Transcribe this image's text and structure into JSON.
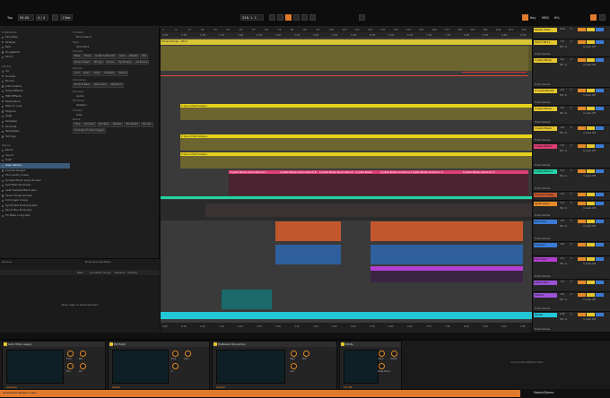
{
  "topbar": {
    "tap": "Tap",
    "tempo": "90.00",
    "signature": "4 / 4",
    "metronome": "1 Bar",
    "position": "226. 1. 1",
    "key": "Key",
    "midi": "MIDI",
    "cpu": "6%"
  },
  "browser": {
    "collections_header": "Collections",
    "collections": [
      "Favorites",
      "Orange",
      "Red",
      "Songstarts",
      "Drum"
    ],
    "library_header": "Library",
    "library": [
      "All",
      "Sounds",
      "Drums",
      "Instruments",
      "Audio Effects",
      "MIDI Effects",
      "Modulators",
      "Max for Live",
      "Plug-Ins",
      "Clips",
      "Samples",
      "Grooves",
      "Templates",
      "Tunings"
    ],
    "places_header": "Places",
    "places": [
      "Packs",
      "Cloud",
      "Push",
      "User Library",
      "Current Project"
    ],
    "user_files": [
      "Flux Audio_2.wav",
      "Sunset Warm Loop 01.wav",
      "Sub Bass Final.wav",
      "Lead Sample Bank.wav",
      "Vocal Chops 04.wav",
      "Kick Layer A.wav",
      "Synth Pad Evolving.wav",
      "Drum Bus Print.wav",
      "FX Riser Long.wav"
    ],
    "filter_col": {
      "content_label": "Content",
      "content_value": "Drum Rack",
      "type_label": "Type",
      "type_value": "One Shot",
      "sound_label": "Sounds",
      "sound_items": [
        "Bass",
        "Brass",
        "Guitar & Plucked",
        "Lead",
        "Mallets",
        "Pad",
        "Piano & Keys",
        "Strings",
        "Voices",
        "Synth Keys",
        "Ambience"
      ],
      "genre_label": "Genres",
      "genre_items": [
        "Acid",
        "Bass",
        "Deep",
        "Dubstep",
        "Techno"
      ],
      "character_label": "Character",
      "character_items": [
        "Drum & Bass",
        "Percussive",
        "Rhythmic"
      ],
      "device_label": "Devices",
      "device_value": "Audio",
      "producer_label": "Producer",
      "producer_value": "Ableton",
      "creator_label": "Creator",
      "creator_value": "User",
      "pack_label": "Packs",
      "file_items": [
        "Clips",
        "Grooves",
        "Samples",
        "Presets",
        "Templates",
        "Tunings",
        "Cmd-Key (Fn Key Trigger)"
      ]
    }
  },
  "groove": {
    "title": "Groove",
    "cols": [
      "Base",
      "Quantize",
      "Timing",
      "Random",
      "Velocity"
    ],
    "empty_hint": "Drop Grooves Here",
    "empty_hint2": "Drop Clips or Grooves Here"
  },
  "arrangement": {
    "ruler_marks": [
      "1",
      "9",
      "17",
      "25",
      "33",
      "41",
      "49",
      "57",
      "65",
      "73",
      "81",
      "89",
      "97",
      "105",
      "113",
      "121",
      "129",
      "137",
      "145",
      "153",
      "161",
      "169",
      "177",
      "185",
      "193",
      "201",
      "209",
      "217",
      "225"
    ],
    "time_marks": [
      "0:00",
      "0:30",
      "1:00",
      "1:30",
      "2:00",
      "2:30",
      "3:00",
      "3:30",
      "4:00",
      "4:30",
      "5:00",
      "5:30",
      "6:00",
      "6:30",
      "7:00",
      "7:30",
      "8:00",
      "8:30",
      "9:00",
      "9:30"
    ],
    "master_clip": "Tempo Tempo - Pitch",
    "yellow_clips": [
      "1 Sound Pad Sample",
      "2 Sound Pad Sample",
      "3 Sound Pad Sample"
    ],
    "pink_clips": [
      "Crystal Bowls Supernatural A",
      "Crystal Bowls Supernatural B",
      "Crystal Bowls Supernatural C",
      "Crystal Bowls",
      "Crystal Bowls Guidance 3",
      "Crystal Bowls Guidance 4",
      "Crystal Bowls Guidance 5"
    ],
    "loop_region": "1/1",
    "end_marker": "1/1"
  },
  "mixer": {
    "tracks": [
      {
        "name": "Master Fader",
        "color": "#e6c62e",
        "vol": "0.00",
        "pan": "C"
      },
      {
        "name": "Sound Pad 1",
        "color": "#e6c62e",
        "vol": "-3.5",
        "pan": "C"
      },
      {
        "name": "Crystal Bowls",
        "color": "#e6c62e",
        "vol": "-6.0",
        "pan": "C"
      },
      {
        "name": "2 Crystal Bowls",
        "color": "#e6c62e",
        "vol": "-6.0",
        "pan": "C"
      },
      {
        "name": "Crystal Bowls",
        "color": "#e6c62e",
        "vol": "-6.0",
        "pan": "C"
      },
      {
        "name": "Crystal Bowls",
        "color": "#e6c62e",
        "vol": "-4.0",
        "pan": "C"
      },
      {
        "name": "Crystal Bowls",
        "color": "#dd3e76",
        "vol": "-3.0",
        "pan": "C"
      },
      {
        "name": "Crystal Bowl 2",
        "color": "#22d3a8",
        "vol": "-2.0",
        "pan": "C"
      },
      {
        "name": "Harmonic Bass",
        "color": "#c2572e",
        "vol": "-1.5",
        "pan": "C"
      },
      {
        "name": "Synth Lead",
        "color": "#e38a2a",
        "vol": "-4.0",
        "pan": "C"
      },
      {
        "name": "Pluck Arp",
        "color": "#3a7bd5",
        "vol": "-5.0",
        "pan": "C"
      },
      {
        "name": "FX Send",
        "color": "#3a7bd5",
        "vol": "-8.0",
        "pan": "C"
      },
      {
        "name": "Sub Layer",
        "color": "#b23fcf",
        "vol": "-2.0",
        "pan": "C"
      },
      {
        "name": "Atmos Pad",
        "color": "#9a52d6",
        "vol": "-7.0",
        "pan": "C"
      },
      {
        "name": "Texture",
        "color": "#9a52d6",
        "vol": "-9.0",
        "pan": "C"
      },
      {
        "name": "Master",
        "color": "#22c7d8",
        "vol": "0.00",
        "pan": "C"
      }
    ],
    "labels": {
      "audio_from": "Audio From",
      "monitor": "In Auto Off",
      "track_volume": "Track Volume",
      "sends": "Sends",
      "ext_in": "Ext. In",
      "no_input": "No Input"
    }
  },
  "devices": [
    {
      "name": "Auto Filter Legacy",
      "params": [
        "Freq",
        "Res",
        "Env",
        "Lfo"
      ],
      "value": "Lowpass"
    },
    {
      "name": "EQ Eight",
      "params": [
        "Freq",
        "Gain",
        "Q"
      ],
      "value": "Stereo"
    },
    {
      "name": "Multiband Dynamics",
      "params": [
        "High",
        "Mid",
        "Low"
      ],
      "value": "Output"
    },
    {
      "name": "Utility",
      "params": [
        "Gain",
        "Width",
        "Bass Mono"
      ],
      "value": "0.0 dB"
    }
  ],
  "devices_drop_hint": "Drop Audio Effects Here",
  "status": {
    "left": "Sound Pad Sample 1.wav",
    "right": "Master/Stereo"
  }
}
